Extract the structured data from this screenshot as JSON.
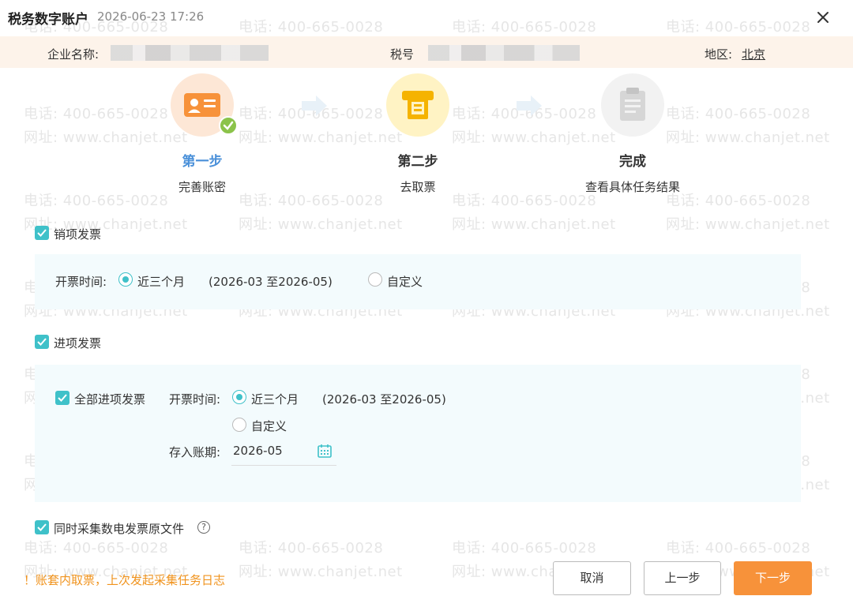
{
  "dialog": {
    "title": "税务数字账户",
    "timestamp": "2026-06-23 17:26"
  },
  "info": {
    "company_label": "企业名称:",
    "tax_label": "税号",
    "region_label": "地区:",
    "region_value": "北京"
  },
  "steps": [
    {
      "title": "第一步",
      "desc": "完善账密",
      "color": "#4a90d9"
    },
    {
      "title": "第二步",
      "desc": "去取票",
      "color": "#333333"
    },
    {
      "title": "完成",
      "desc": "查看具体任务结果",
      "color": "#333333"
    }
  ],
  "sales": {
    "label": "销项发票",
    "time_label": "开票时间:",
    "option_recent": "近三个月",
    "range": "(2026-03 至2026-05)",
    "option_custom": "自定义"
  },
  "purchase": {
    "label": "进项发票",
    "all_label": "全部进项发票",
    "time_label": "开票时间:",
    "option_recent": "近三个月",
    "range": "(2026-03 至2026-05)",
    "option_custom": "自定义",
    "period_label": "存入账期:",
    "period_value": "2026-05"
  },
  "collect_original": {
    "label": "同时采集数电发票原文件"
  },
  "footer": {
    "note": "！账套内取票，上次发起采集任务日志",
    "cancel": "取消",
    "prev": "上一步",
    "next": "下一步"
  },
  "watermark": {
    "phone": "电话: 400-665-0028",
    "site": "网址: www.chanjet.net"
  },
  "colors": {
    "accent": "#3fc1c9",
    "primary_button": "#f7923a",
    "step_active": "#4a90d9",
    "note": "#f0931d"
  }
}
